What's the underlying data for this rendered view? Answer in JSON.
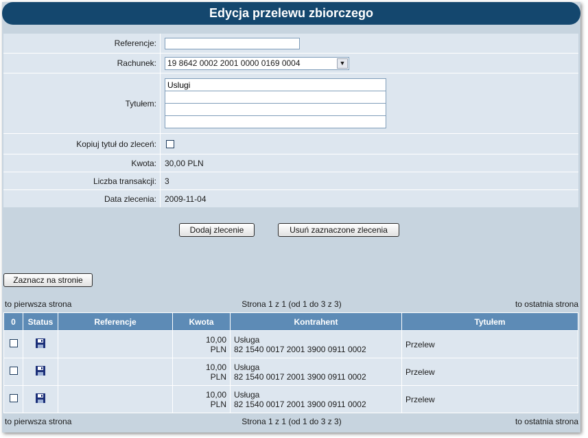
{
  "title": "Edycja przelewu zbiorczego",
  "form": {
    "reference_label": "Referencje:",
    "reference_value": "",
    "account_label": "Rachunek:",
    "account_value": "19 8642 0002 2001 0000 0169 0004",
    "title_label": "Tytułem:",
    "title_lines": [
      "Uslugi",
      "",
      "",
      ""
    ],
    "copy_title_label": "Kopiuj tytuł do zleceń:",
    "copy_title_checked": false,
    "amount_label": "Kwota:",
    "amount_value": "30,00 PLN",
    "tx_count_label": "Liczba transakcji:",
    "tx_count_value": "3",
    "order_date_label": "Data zlecenia:",
    "order_date_value": "2009-11-04"
  },
  "buttons": {
    "add_order": "Dodaj zlecenie",
    "delete_selected": "Usuń zaznaczone zlecenia",
    "select_page": "Zaznacz na stronie"
  },
  "pager": {
    "first": "to pierwsza strona",
    "info": "Strona 1 z 1 (od 1 do 3 z 3)",
    "last": "to ostatnia strona"
  },
  "table": {
    "headers": [
      "0",
      "Status",
      "Referencje",
      "Kwota",
      "Kontrahent",
      "Tytułem"
    ],
    "rows": [
      {
        "reference": "",
        "amount": "10,00",
        "currency": "PLN",
        "contractor_name": "Usługa",
        "contractor_account": "82 1540 0017 2001 3900 0911 0002",
        "title": "Przelew",
        "status_icon": "floppy-disk-icon"
      },
      {
        "reference": "",
        "amount": "10,00",
        "currency": "PLN",
        "contractor_name": "Usługa",
        "contractor_account": "82 1540 0017 2001 3900 0911 0002",
        "title": "Przelew",
        "status_icon": "floppy-disk-icon"
      },
      {
        "reference": "",
        "amount": "10,00",
        "currency": "PLN",
        "contractor_name": "Usługa",
        "contractor_account": "82 1540 0017 2001 3900 0911 0002",
        "title": "Przelew",
        "status_icon": "floppy-disk-icon"
      }
    ]
  },
  "colors": {
    "title_bar": "#14476e",
    "header": "#5d8bb6",
    "panel": "#c7d4df",
    "row": "#dde6ef"
  }
}
